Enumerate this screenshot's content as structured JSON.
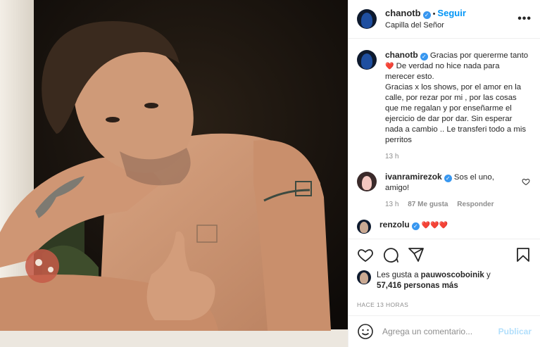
{
  "header": {
    "username": "chanotb",
    "dot": "•",
    "follow_label": "Seguir",
    "location": "Capilla del Señor",
    "more_icon": "more-options-icon",
    "verified_mark": "✓"
  },
  "comments": [
    {
      "username": "chanotb",
      "text_part1": "Gracias por quererme tanto",
      "heart": "❤️",
      "text_part2": " De verdad no hice nada para merecer esto.",
      "text_part3": "Gracias x los shows, por el amor en la calle, por rezar por mi , por las cosas que me regalan y por enseñarme el ejercicio de dar por dar. Sin esperar nada a cambio .. Le transferi todo a mis perritos",
      "time": "13 h"
    },
    {
      "username": "ivanramirezok",
      "text": "Sos el uno, amigo!",
      "time": "13 h",
      "likes": "87 Me gusta",
      "reply_label": "Responder"
    },
    {
      "username": "renzolu",
      "text": "❤️❤️❤️"
    }
  ],
  "actions": {
    "like_icon": "heart-icon",
    "comment_icon": "comment-icon",
    "share_icon": "share-icon",
    "save_icon": "bookmark-icon"
  },
  "likes": {
    "prefix": "Les gusta a ",
    "user": "pauwoscoboinik",
    "mid": " y",
    "count": "57,416 personas más"
  },
  "timestamp": "HACE 13 HORAS",
  "add_comment": {
    "placeholder": "Agrega un comentario...",
    "publish_label": "Publicar",
    "emoji_icon": "emoji-icon"
  },
  "colors": {
    "accent": "#0095f6",
    "verified": "#3897f0",
    "heart": "#ed4956"
  }
}
